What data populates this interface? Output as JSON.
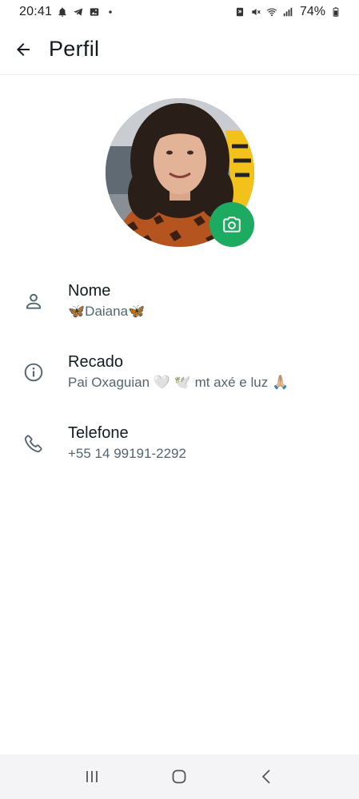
{
  "status_bar": {
    "time": "20:41",
    "battery": "74%",
    "left_icons": [
      "notification-bell-icon",
      "telegram-icon",
      "gallery-icon",
      "dot-icon"
    ],
    "right_icons": [
      "nfc-icon",
      "mute-icon",
      "wifi-icon",
      "signal-icon",
      "battery-icon"
    ]
  },
  "header": {
    "title": "Perfil",
    "back_icon": "arrow-left-icon"
  },
  "profile": {
    "camera_icon": "camera-icon",
    "accent_color": "#1daa61"
  },
  "fields": {
    "name": {
      "label": "Nome",
      "value": "🦋Daiana🦋",
      "icon": "person-icon"
    },
    "about": {
      "label": "Recado",
      "value": "Pai Oxaguian 🤍 🕊️ mt axé e luz 🙏🏼",
      "icon": "info-icon"
    },
    "phone": {
      "label": "Telefone",
      "value": "+55 14 99191-2292",
      "icon": "phone-icon"
    }
  },
  "nav_bar": {
    "icons": [
      "recent-apps-icon",
      "home-icon",
      "back-nav-icon"
    ]
  }
}
